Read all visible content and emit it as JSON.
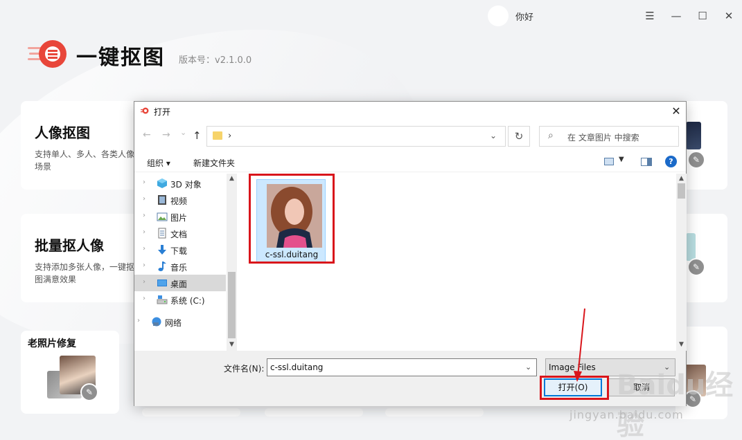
{
  "app": {
    "username": "你好",
    "name": "一键抠图",
    "version": "版本号：v2.1.0.0",
    "brand_color": "#e8463a"
  },
  "window_controls": {
    "menu": "☰",
    "minimize": "—",
    "maximize": "☐",
    "close": "✕"
  },
  "cards": [
    {
      "title": "人像抠图",
      "desc": "支持单人、多人、各类人像场景"
    },
    {
      "title": "批量抠人像",
      "desc": "支持添加多张人像，一键抠图满意效果"
    },
    {
      "title": "老照片修复"
    }
  ],
  "dialog": {
    "title": "打开",
    "close": "✕",
    "nav": {
      "back": "←",
      "forward": "→",
      "recent": "⌄",
      "up": "↑",
      "sep": "›",
      "refresh": "↻"
    },
    "search_placeholder": "在 文章图片 中搜索",
    "toolbar": {
      "organize": "组织 ▾",
      "new_folder": "新建文件夹",
      "help": "?"
    },
    "tree": [
      {
        "label": "3D 对象",
        "icon": "3d-objects-icon"
      },
      {
        "label": "视频",
        "icon": "video-icon"
      },
      {
        "label": "图片",
        "icon": "pictures-icon"
      },
      {
        "label": "文档",
        "icon": "documents-icon"
      },
      {
        "label": "下载",
        "icon": "downloads-icon"
      },
      {
        "label": "音乐",
        "icon": "music-icon"
      },
      {
        "label": "桌面",
        "icon": "desktop-icon",
        "selected": true
      },
      {
        "label": "系统 (C:)",
        "icon": "drive-icon"
      },
      {
        "label": "网络",
        "icon": "network-icon"
      }
    ],
    "file": {
      "name": "c-ssl.duitang"
    },
    "filename_label": "文件名(N):",
    "filename_value": "c-ssl.duitang",
    "filetype_value": "Image Files",
    "open_label": "打开(O)",
    "cancel_label": "取消",
    "highlight_color": "#d9151b"
  },
  "watermark": {
    "text": "jingyan.baidu.com",
    "logo": "Baidu经验"
  }
}
